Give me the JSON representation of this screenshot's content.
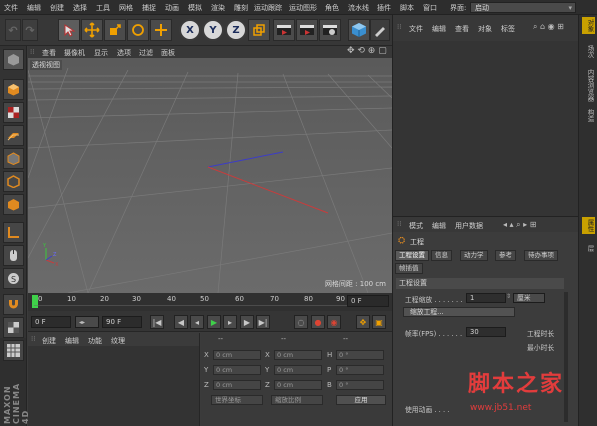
{
  "menubar": {
    "items": [
      "文件",
      "编辑",
      "创建",
      "选择",
      "工具",
      "网格",
      "捕捉",
      "动画",
      "模拟",
      "渲染",
      "雕刻",
      "运动跟踪",
      "运动图形",
      "角色",
      "流水线",
      "插件",
      "脚本",
      "窗口",
      "帮助"
    ],
    "layout_label": "界面:",
    "layout_value": "启动"
  },
  "toolbar": {
    "axis_x": "X",
    "axis_y": "Y",
    "axis_z": "Z"
  },
  "viewport": {
    "menu": [
      "查看",
      "摄像机",
      "显示",
      "选项",
      "过滤",
      "面板"
    ],
    "view_label": "透视视图",
    "grid_spacing": "网格间距 : 100 cm"
  },
  "timeline": {
    "ticks": [
      "0",
      "10",
      "20",
      "30",
      "40",
      "50",
      "60",
      "70",
      "80",
      "90"
    ],
    "current_frame": "0 F"
  },
  "transport": {
    "start_frame": "0 F",
    "end_frame": "90 F"
  },
  "materials": {
    "menu": [
      "创建",
      "编辑",
      "功能",
      "纹理"
    ]
  },
  "coordinates": {
    "header_a": "--",
    "header_b": "--",
    "header_c": "--",
    "rows": [
      {
        "a_label": "X",
        "a_value": "0 cm",
        "b_label": "X",
        "b_value": "0 cm",
        "c_label": "H",
        "c_value": "0 °"
      },
      {
        "a_label": "Y",
        "a_value": "0 cm",
        "b_label": "Y",
        "b_value": "0 cm",
        "c_label": "P",
        "c_value": "0 °"
      },
      {
        "a_label": "Z",
        "a_value": "0 cm",
        "b_label": "Z",
        "b_value": "0 cm",
        "c_label": "B",
        "c_value": "0 °"
      }
    ],
    "world_select": "世界坐标",
    "scale_select": "缩放比例",
    "apply_button": "应用"
  },
  "objects": {
    "menu": [
      "文件",
      "编辑",
      "查看",
      "对象",
      "标签"
    ]
  },
  "right_tabs": [
    "对象",
    "场次",
    "内容浏览器",
    "构造",
    "属性",
    "层"
  ],
  "attributes": {
    "menu": [
      "模式",
      "编辑",
      "用户数据"
    ],
    "title": "工程",
    "tabs": [
      "工程设置",
      "信息",
      "动力学",
      "参考",
      "待办事项",
      "帧插值"
    ],
    "section": "工程设置",
    "scale_label": "工程缩放 . . . . . . .",
    "scale_value": "1",
    "scale_unit": "厘米",
    "scale_button": "缩放工程...",
    "fps_label": "帧率(FPS) . . . . . .",
    "fps_value": "30",
    "duration_label": "工程时长",
    "min_label": "最小时长",
    "footer": "使用动画 . . . ."
  },
  "watermark": {
    "brand": "脚本之家",
    "url": "www.jb51.net"
  },
  "brand_side": "MAXON CINEMA 4D"
}
